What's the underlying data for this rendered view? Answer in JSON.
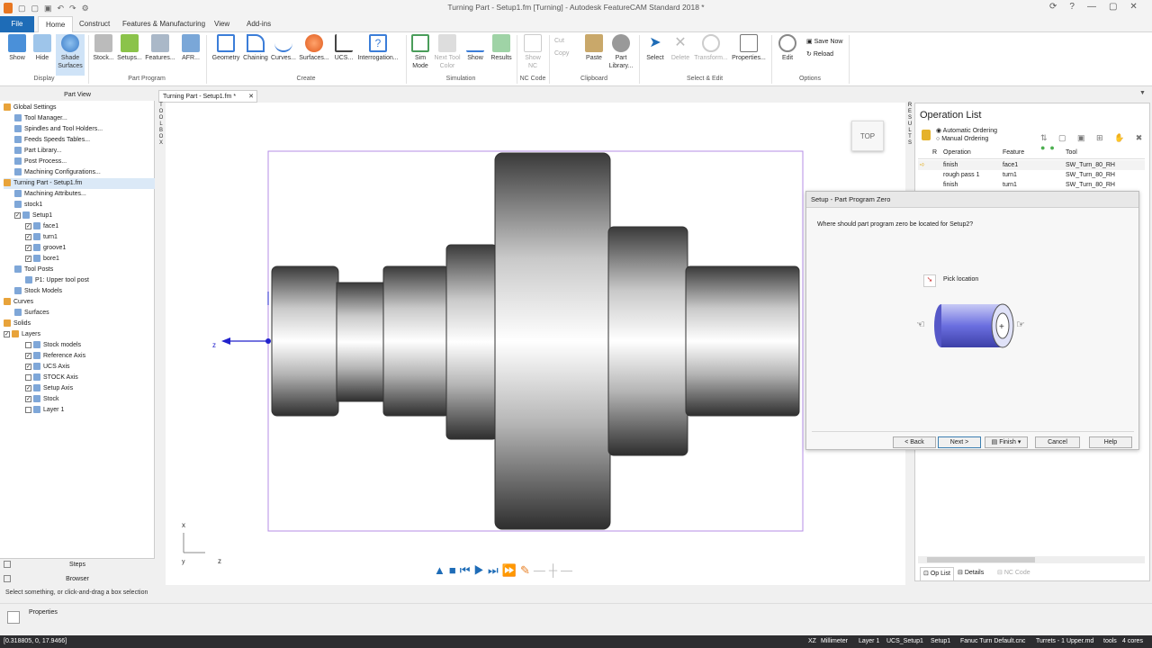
{
  "window": {
    "title": "Turning Part - Setup1.fm [Turning] - Autodesk FeatureCAM Standard 2018 *"
  },
  "tabs": [
    "File",
    "Home",
    "Construct",
    "Features & Manufacturing",
    "View",
    "Add-ins"
  ],
  "ribbon": {
    "display": {
      "label": "Display",
      "buttons": [
        "Show",
        "Hide",
        "Shade\nSurfaces"
      ]
    },
    "part_program": {
      "label": "Part Program",
      "buttons": [
        "Stock...",
        "Setups...",
        "Features...",
        "AFR..."
      ]
    },
    "create": {
      "label": "Create",
      "buttons": [
        "Geometry",
        "Chaining",
        "Curves...",
        "Surfaces...",
        "UCS...",
        "Interrogation..."
      ]
    },
    "simulation": {
      "label": "Simulation",
      "buttons": [
        "Sim\nMode",
        "Next Tool\nColor",
        "Show",
        "Results"
      ]
    },
    "nc_code": {
      "label": "NC Code",
      "buttons": [
        "Show\nNC"
      ]
    },
    "clipboard": {
      "label": "Clipboard",
      "small": [
        "Cut",
        "Copy"
      ],
      "buttons": [
        "Paste",
        "Part\nLibrary..."
      ]
    },
    "select_edit": {
      "label": "Select & Edit",
      "buttons": [
        "Select",
        "Delete",
        "Transform...",
        "Properties..."
      ]
    },
    "options": {
      "label": "Options",
      "buttons": [
        "Edit"
      ],
      "small": [
        "Save Now",
        "Reload"
      ]
    }
  },
  "left_panel": {
    "title": "Part View",
    "items": [
      {
        "label": "Global Settings",
        "level": 0
      },
      {
        "label": "Tool Manager...",
        "level": 1
      },
      {
        "label": "Spindles and Tool Holders...",
        "level": 1
      },
      {
        "label": "Feeds  Speeds Tables...",
        "level": 1
      },
      {
        "label": "Part Library...",
        "level": 1
      },
      {
        "label": "Post Process...",
        "level": 1
      },
      {
        "label": "Machining Configurations...",
        "level": 1
      },
      {
        "label": "Turning Part - Setup1.fm",
        "level": 0,
        "highlight": true
      },
      {
        "label": "Machining Attributes...",
        "level": 1
      },
      {
        "label": "stock1",
        "level": 1
      },
      {
        "label": "Setup1",
        "level": 1,
        "check": true
      },
      {
        "label": "face1",
        "level": 2,
        "check": true
      },
      {
        "label": "turn1",
        "level": 2,
        "check": true
      },
      {
        "label": "groove1",
        "level": 2,
        "check": true
      },
      {
        "label": "bore1",
        "level": 2,
        "check": true
      },
      {
        "label": "Tool Posts",
        "level": 1
      },
      {
        "label": "P1: Upper tool post",
        "level": 2
      },
      {
        "label": "Stock Models",
        "level": 1
      },
      {
        "label": "Curves",
        "level": 0
      },
      {
        "label": "Surfaces",
        "level": 1
      },
      {
        "label": "Solids",
        "level": 0
      },
      {
        "label": "Layers",
        "level": 0,
        "check": true
      },
      {
        "label": "Stock models",
        "level": 2,
        "check": false
      },
      {
        "label": "Reference Axis",
        "level": 2,
        "check": true
      },
      {
        "label": "UCS Axis",
        "level": 2,
        "check": true
      },
      {
        "label": "STOCK Axis",
        "level": 2,
        "check": false
      },
      {
        "label": "Setup Axis",
        "level": 2,
        "check": true
      },
      {
        "label": "Stock",
        "level": 2,
        "check": true
      },
      {
        "label": "Layer 1",
        "level": 2,
        "check": false
      }
    ],
    "bottom_tabs": [
      "Steps",
      "Browser"
    ]
  },
  "hint": "Select something, or click-and-drag a box selection",
  "properties_label": "Properties",
  "doc_tab": "Turning Part - Setup1.fm *",
  "toolbox_label": "TOOLBOX",
  "viewport": {
    "view_label": "TOP",
    "axis_z": "z",
    "axis_x": "x",
    "axis_y": "y"
  },
  "results_label": "RESULTS",
  "operation_list": {
    "title": "Operation List",
    "ordering": [
      "Automatic Ordering",
      "Manual Ordering"
    ],
    "columns": [
      "R",
      "Operation",
      "Feature",
      "Tool"
    ],
    "rows": [
      {
        "operation": "finish",
        "feature": "face1",
        "tool": "SW_Turn_80_RH"
      },
      {
        "operation": "rough pass 1",
        "feature": "turn1",
        "tool": "SW_Turn_80_RH"
      },
      {
        "operation": "finish",
        "feature": "turn1",
        "tool": "SW_Turn_80_RH"
      }
    ],
    "bottom_tabs": [
      "Op List",
      "Details",
      "NC Code"
    ]
  },
  "dialog": {
    "title": "Setup - Part Program Zero",
    "question": "Where should part program zero be located for Setup2?",
    "pick_label": "Pick location",
    "buttons": [
      "< Back",
      "Next >",
      "Finish",
      "Cancel",
      "Help"
    ]
  },
  "statusbar": {
    "coords": "[0.318805, 0, 17.9466]",
    "items": [
      "XZ",
      "Millimeter",
      "Layer 1",
      "UCS_Setup1",
      "Setup1",
      "Fanuc Turn Default.cnc",
      "Turrets - 1 Upper.md",
      "tools",
      "4 cores"
    ]
  },
  "colors": {
    "accent": "#1e6cb7",
    "part_outline": "#8a2be2",
    "dialog_cylinder": "#6b6fe0"
  }
}
